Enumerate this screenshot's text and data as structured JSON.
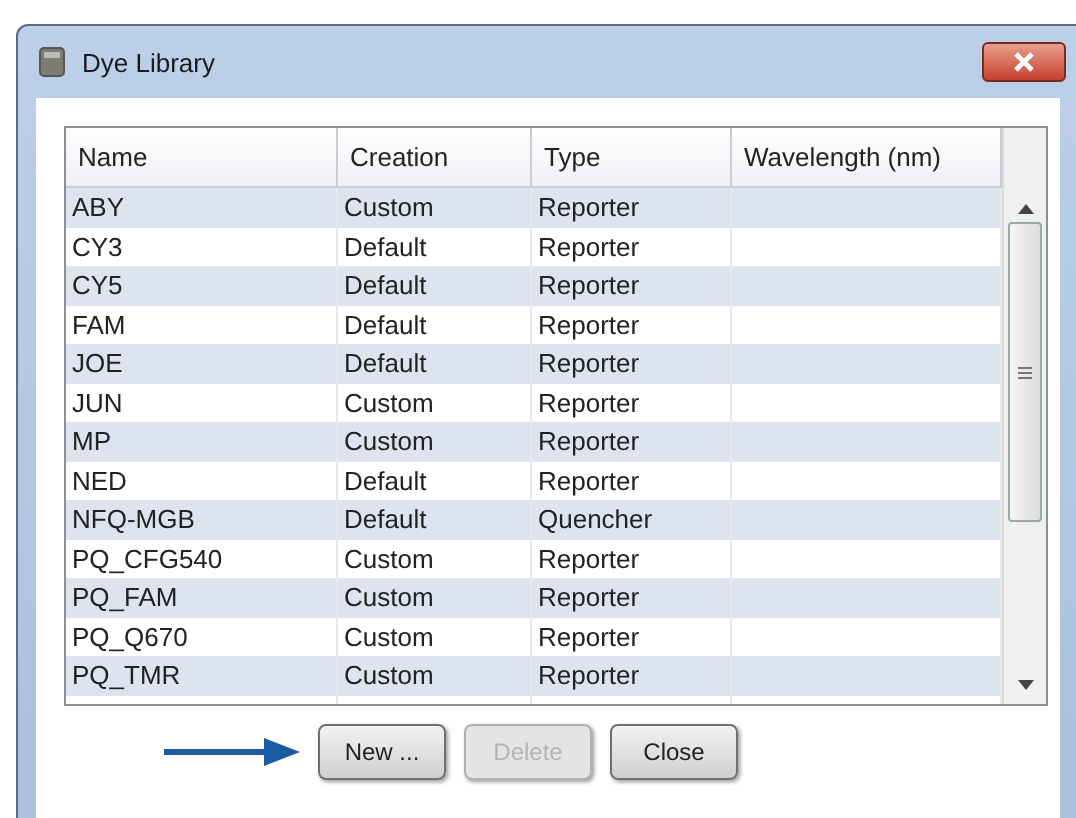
{
  "window": {
    "title": "Dye Library"
  },
  "table": {
    "columns": [
      "Name",
      "Creation",
      "Type",
      "Wavelength (nm)"
    ],
    "rows": [
      [
        "ABY",
        "Custom",
        "Reporter",
        ""
      ],
      [
        "CY3",
        "Default",
        "Reporter",
        ""
      ],
      [
        "CY5",
        "Default",
        "Reporter",
        ""
      ],
      [
        "FAM",
        "Default",
        "Reporter",
        ""
      ],
      [
        "JOE",
        "Default",
        "Reporter",
        ""
      ],
      [
        "JUN",
        "Custom",
        "Reporter",
        ""
      ],
      [
        "MP",
        "Custom",
        "Reporter",
        ""
      ],
      [
        "NED",
        "Default",
        "Reporter",
        ""
      ],
      [
        "NFQ-MGB",
        "Default",
        "Quencher",
        ""
      ],
      [
        "PQ_CFG540",
        "Custom",
        "Reporter",
        ""
      ],
      [
        "PQ_FAM",
        "Custom",
        "Reporter",
        ""
      ],
      [
        "PQ_Q670",
        "Custom",
        "Reporter",
        ""
      ],
      [
        "PQ_TMR",
        "Custom",
        "Reporter",
        ""
      ]
    ]
  },
  "buttons": [
    {
      "label": "New ...",
      "disabled": false
    },
    {
      "label": "Delete",
      "disabled": true
    },
    {
      "label": "Close",
      "disabled": false
    }
  ]
}
